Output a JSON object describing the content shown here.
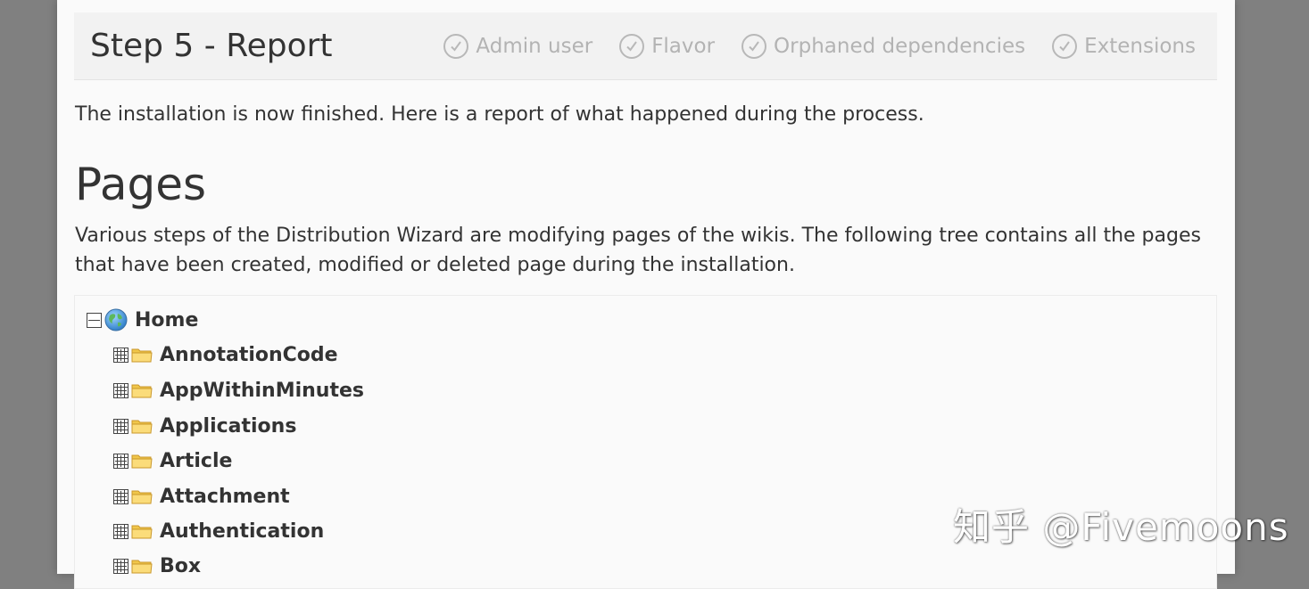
{
  "header": {
    "title": "Step 5 - Report",
    "steps": [
      {
        "label": "Admin user",
        "icon": "check-circle-icon"
      },
      {
        "label": "Flavor",
        "icon": "check-circle-icon"
      },
      {
        "label": "Orphaned dependencies",
        "icon": "check-circle-icon"
      },
      {
        "label": "Extensions",
        "icon": "check-circle-icon"
      }
    ]
  },
  "intro": "The installation is now finished. Here is a report of what happened during the process.",
  "pages_section": {
    "title": "Pages",
    "description": "Various steps of the Distribution Wizard are modifying pages of the wikis. The following tree contains all the pages that have been created, modified or deleted page during the installation.",
    "tree": {
      "root": {
        "label": "Home",
        "expanded": true,
        "icon": "globe-icon"
      },
      "children": [
        {
          "label": "AnnotationCode",
          "icon": "folder-icon"
        },
        {
          "label": "AppWithinMinutes",
          "icon": "folder-icon"
        },
        {
          "label": "Applications",
          "icon": "folder-icon"
        },
        {
          "label": "Article",
          "icon": "folder-icon"
        },
        {
          "label": "Attachment",
          "icon": "folder-icon"
        },
        {
          "label": "Authentication",
          "icon": "folder-icon"
        },
        {
          "label": "Box",
          "icon": "folder-icon"
        }
      ]
    }
  },
  "watermark": "知乎 @Fivemoons",
  "colors": {
    "background": "#808080",
    "panel": "#fafafa",
    "muted": "#b3b3b3",
    "text": "#333333"
  }
}
